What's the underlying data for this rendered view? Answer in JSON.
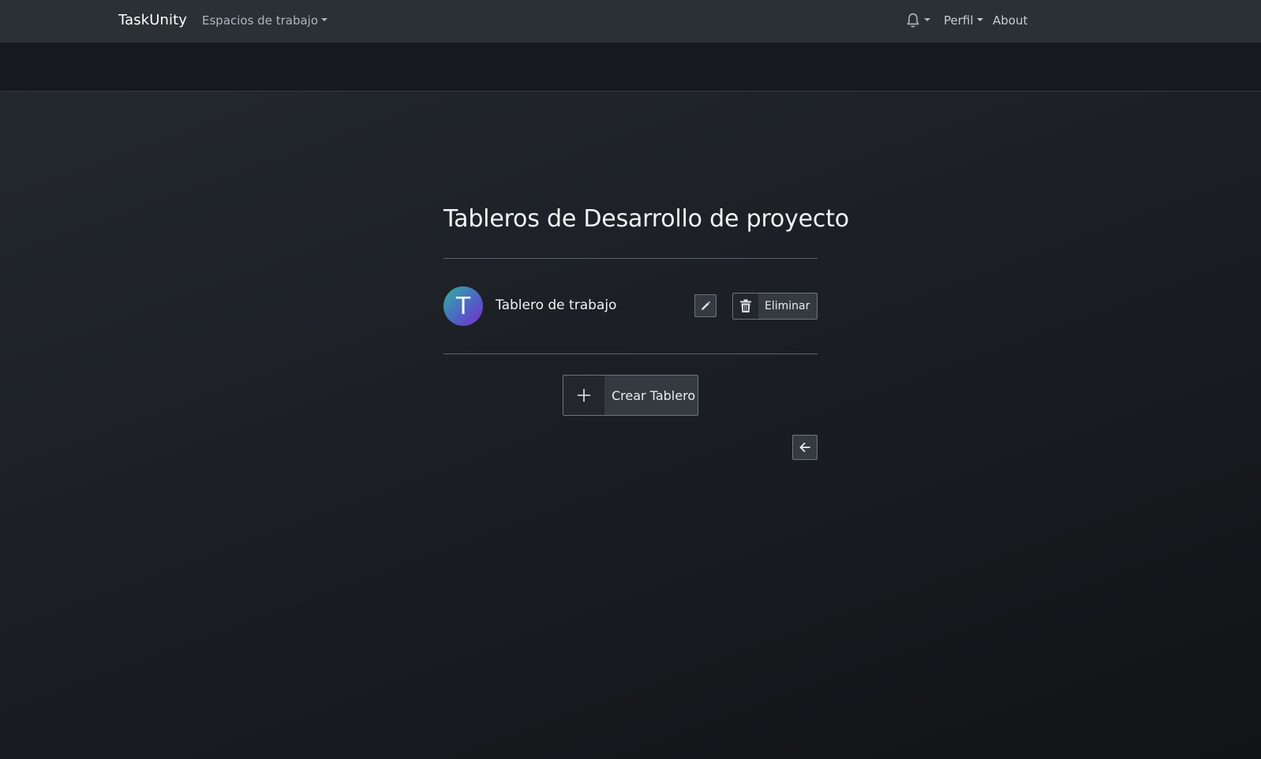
{
  "navbar": {
    "brand": "TaskUnity",
    "workspaces_label": "Espacios de trabajo",
    "notifications_icon": "bell-icon",
    "profile_label": "Perfil",
    "about_label": "About"
  },
  "main": {
    "title": "Tableros de Desarrollo de proyecto",
    "boards": [
      {
        "avatar_letter": "T",
        "name": "Tablero de trabajo",
        "edit_icon": "pencil-icon",
        "delete_icon": "trash-icon",
        "delete_label": "Eliminar"
      }
    ],
    "create_icon": "plus-icon",
    "create_label": "Crear Tablero",
    "back_icon": "arrow-left-icon"
  },
  "colors": {
    "navbar_bg": "#2b3035",
    "subbar_bg": "#16191d",
    "button_bg": "#343a40",
    "avatar_gradient_start": "#2fb3a0",
    "avatar_gradient_end": "#7a2fc9"
  }
}
